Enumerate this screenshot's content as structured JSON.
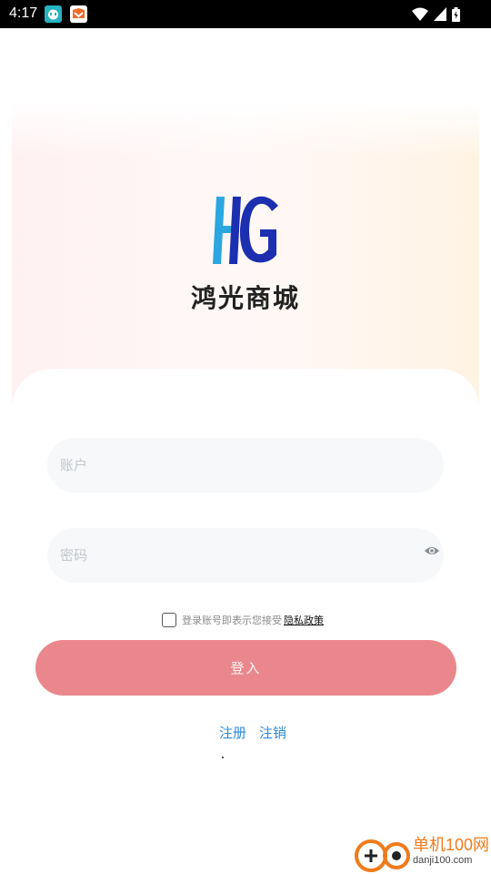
{
  "status_bar": {
    "time": "4:17",
    "icons": [
      "app-notification-icon-1",
      "app-notification-icon-2",
      "wifi-icon",
      "signal-icon",
      "battery-icon"
    ]
  },
  "app": {
    "name": "鸿光商城",
    "logo": "HG",
    "colors": {
      "logo_blue": "#1c2fb0",
      "logo_cyan": "#2aa7e0",
      "accent": "#e9878d",
      "link": "#2e8ad8"
    }
  },
  "form": {
    "account_placeholder": "账户",
    "account_value": "",
    "password_placeholder": "密码",
    "password_value": "",
    "agree_text": "登录账号即表示您接受",
    "privacy_link": "隐私政策",
    "agree_checked": false,
    "login_label": "登入",
    "register_link": "注册",
    "deregister_link": "注销"
  },
  "watermark": {
    "title": "单机100网",
    "url": "danji100.com"
  }
}
